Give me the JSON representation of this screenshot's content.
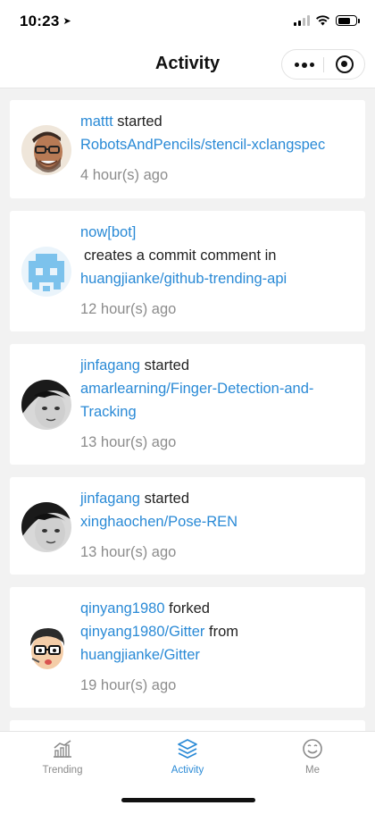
{
  "status_bar": {
    "time": "10:23",
    "location_icon": "location-arrow-icon",
    "signal_icon": "cellular-signal-icon",
    "wifi_icon": "wifi-icon",
    "battery_icon": "battery-icon"
  },
  "nav": {
    "title": "Activity",
    "more_icon": "more-dots-icon",
    "close_icon": "target-close-icon"
  },
  "colors": {
    "link": "#2a8ad6",
    "time_text": "#8c8c8c",
    "page_background": "#f2f2f2",
    "active_tab": "#2a8ad6",
    "inactive_tab": "#8a8a8a"
  },
  "activities": [
    {
      "user": "mattt",
      "action": "started",
      "repo": "RobotsAndPencils/stencil-xclangspec",
      "time": "4 hour(s) ago"
    },
    {
      "user": "now[bot]",
      "action": "creates a commit comment in",
      "repo": "huangjianke/github-trending-api",
      "time": "12 hour(s) ago"
    },
    {
      "user": "jinfagang",
      "action": "started",
      "repo": "amarlearning/Finger-Detection-and-Tracking",
      "time": "13 hour(s) ago"
    },
    {
      "user": "jinfagang",
      "action": "started",
      "repo": "xinghaochen/Pose-REN",
      "time": "13 hour(s) ago"
    },
    {
      "user": "qinyang1980",
      "action": "forked",
      "repo": "qinyang1980/Gitter",
      "connector": "from",
      "source_repo": "huangjianke/Gitter",
      "time": "19 hour(s) ago"
    }
  ],
  "tabs": [
    {
      "label": "Trending",
      "icon": "trending-chart-icon",
      "active": false
    },
    {
      "label": "Activity",
      "icon": "activity-layers-icon",
      "active": true
    },
    {
      "label": "Me",
      "icon": "smiley-face-icon",
      "active": false
    }
  ]
}
